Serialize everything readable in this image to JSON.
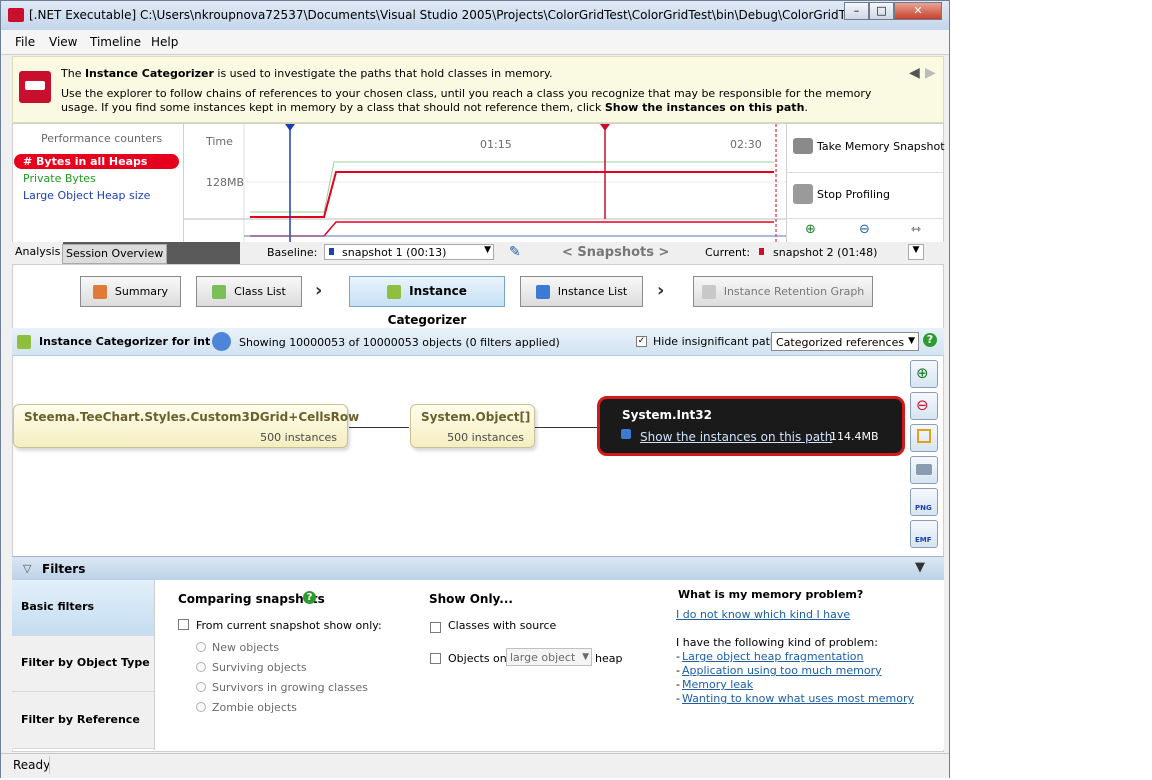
{
  "window": {
    "title": "[.NET Executable] C:\\Users\\nkroupnova72537\\Documents\\Visual Studio 2005\\Projects\\ColorGridTest\\ColorGridTest\\bin\\Debug\\ColorGridTest.exe - AN..."
  },
  "menu": [
    "File",
    "View",
    "Timeline",
    "Help"
  ],
  "info": {
    "line1_pre": "The ",
    "line1_bold": "Instance Categorizer",
    "line1_post": " is used to investigate the paths that hold classes in memory.",
    "line2_pre": "Use the explorer to follow chains of references to your chosen class, until you reach a class you recognize that may be responsible for the memory usage. If you find some instances kept in memory by a class that should not reference them, click ",
    "line2_bold": "Show the instances on this path",
    "line2_post": "."
  },
  "perf": {
    "heading": "Performance counters",
    "counters": [
      "# Bytes in all Heaps",
      "Private Bytes",
      "Large Object Heap size"
    ],
    "time_label": "Time",
    "ticks": [
      "01:15",
      "02:30"
    ],
    "ylabel": "128MB",
    "take_snapshot": "Take Memory Snapshot",
    "stop_profiling": "Stop Profiling"
  },
  "tabs": {
    "analysis": "Analysis",
    "session": "Session Overview",
    "baseline_label": "Baseline:",
    "baseline_value": "snapshot 1 (00:13)",
    "snapshots": "< Snapshots >",
    "current_label": "Current:",
    "current_value": "snapshot 2 (01:48)"
  },
  "nav": {
    "summary": "Summary",
    "class_list": "Class List",
    "instance_categorizer": "Instance Categorizer",
    "instance_list": "Instance List",
    "retention_graph": "Instance Retention Graph"
  },
  "categorizer": {
    "title": "Instance Categorizer for int",
    "showing": "Showing 10000053 of 10000053 objects (0 filters applied)",
    "hide_label": "Hide insignificant paths",
    "mode": "Categorized references"
  },
  "graph": {
    "nodes": [
      {
        "name": "Steema.TeeChart.Styles.Custom3DGrid+CellsRow",
        "count": "500 instances"
      },
      {
        "name": "System.Object[]",
        "count": "500 instances"
      }
    ],
    "selected": {
      "name": "System.Int32",
      "link": "Show the instances on this path",
      "size": "114.4MB"
    }
  },
  "filters": {
    "title": "Filters",
    "tabs": [
      "Basic filters",
      "Filter by Object Type",
      "Filter by Reference"
    ],
    "comparing_title": "Comparing snapshots",
    "from_current": "From current snapshot show only:",
    "radios": [
      "New objects",
      "Surviving objects",
      "Survivors in growing classes",
      "Zombie objects"
    ],
    "show_only_title": "Show Only...",
    "classes_with_source": "Classes with source",
    "objects_on": "Objects on",
    "heap_select": "large object",
    "heap": "heap",
    "problem_title": "What is my memory problem?",
    "dont_know": "I do not know which kind I have",
    "have_following": "I have the following kind of problem:",
    "problems": [
      "Large object heap fragmentation",
      "Application using too much memory",
      "Memory leak",
      "Wanting to know what uses most memory"
    ]
  },
  "status": "Ready"
}
